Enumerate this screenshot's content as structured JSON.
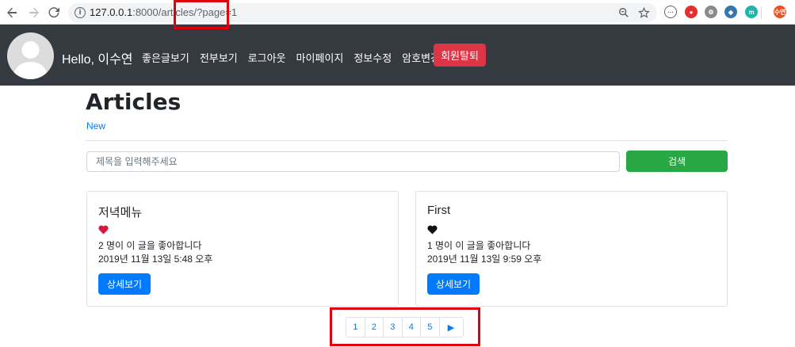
{
  "browser": {
    "url_host": "127.0.0.1",
    "url_path": ":8000/articles/?page=1"
  },
  "navbar": {
    "greeting": "Hello, 이수연",
    "links": [
      "좋은글보기",
      "전부보기",
      "로그아웃",
      "마이페이지",
      "정보수정",
      "암호변경"
    ],
    "withdraw_label": "회원탈퇴"
  },
  "page": {
    "title": "Articles",
    "new_link": "New"
  },
  "search": {
    "placeholder": "제목을 입력해주세요",
    "button_label": "검색"
  },
  "articles": [
    {
      "title": "저녁메뉴",
      "heart_color": "#dc143c",
      "likes_text": "2 명이 이 글을 좋아합니다",
      "date": "2019년 11월 13일 5:48 오후",
      "button_label": "상세보기"
    },
    {
      "title": "First",
      "heart_color": "#111111",
      "likes_text": "1 명이 이 글을 좋아합니다",
      "date": "2019년 11월 13일 9:59 오후",
      "button_label": "상세보기"
    }
  ],
  "pagination": {
    "pages": [
      "1",
      "2",
      "3",
      "4",
      "5"
    ],
    "next_label": "▶"
  },
  "colors": {
    "navbar_bg": "#343a40",
    "primary": "#007bff",
    "success": "#28a745",
    "danger": "#dc3545",
    "highlight": "#e0000b"
  },
  "extensions": {
    "profile_label": "수연"
  }
}
